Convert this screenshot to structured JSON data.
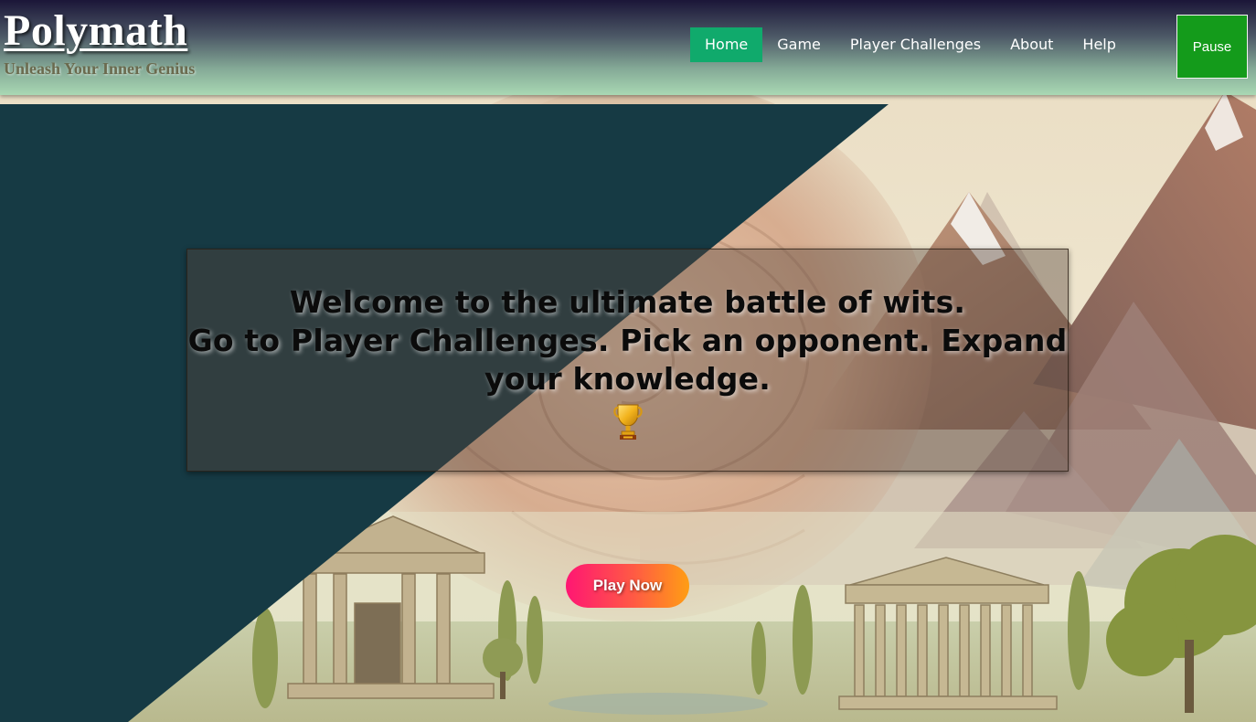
{
  "brand": {
    "title": "Polymath",
    "tagline": "Unleash Your Inner Genius"
  },
  "nav": {
    "items": [
      {
        "label": "Home",
        "active": true
      },
      {
        "label": "Game",
        "active": false
      },
      {
        "label": "Player Challenges",
        "active": false
      },
      {
        "label": "About",
        "active": false
      },
      {
        "label": "Help",
        "active": false
      }
    ],
    "pause_label": "Pause"
  },
  "hero": {
    "line1": "Welcome to the ultimate battle of wits.",
    "line2": "Go to Player Challenges. Pick an opponent. Expand your knowledge.",
    "icon": "trophy-icon",
    "play_label": "Play Now"
  },
  "colors": {
    "nav_active": "#10aa6c",
    "pause_button": "#149b1b",
    "diagonal_panel": "#163a44",
    "play_gradient_start": "#ff1673",
    "play_gradient_end": "#ff9e14"
  }
}
